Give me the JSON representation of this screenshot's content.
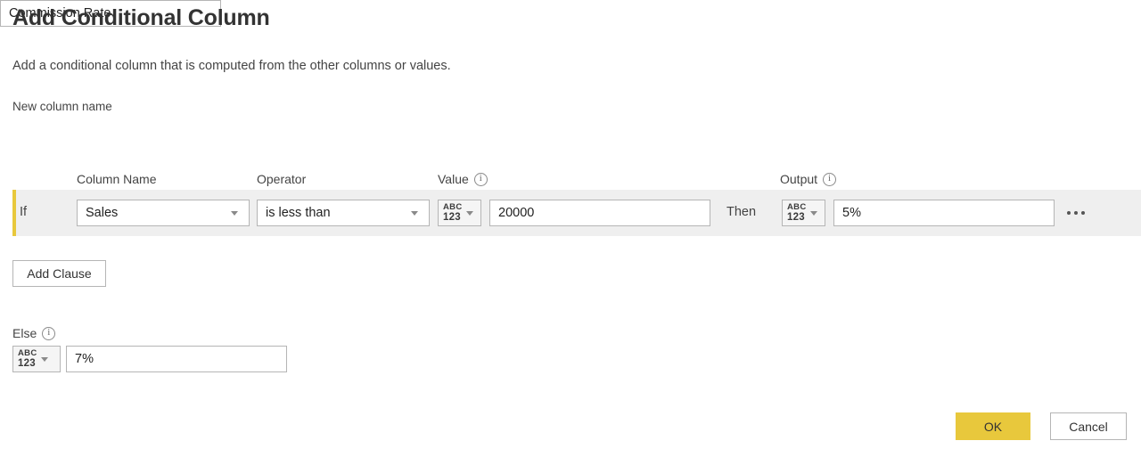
{
  "dialog": {
    "title": "Add Conditional Column",
    "description": "Add a conditional column that is computed from the other columns or values."
  },
  "new_column": {
    "label": "New column name",
    "value": "Commission Rate",
    "placeholder": "New column name"
  },
  "headers": {
    "column_name": "Column Name",
    "operator": "Operator",
    "value": "Value",
    "output": "Output",
    "value_info_icon": "info-icon",
    "output_info_icon": "info-icon"
  },
  "clause": {
    "if_label": "If",
    "then_label": "Then",
    "column_name": "Sales",
    "operator": "is less than",
    "value_type": {
      "abc": "ABC",
      "num": "123"
    },
    "value": "20000",
    "value_placeholder": "Enter a value",
    "output_type": {
      "abc": "ABC",
      "num": "123"
    },
    "output": "5%",
    "output_placeholder": "Enter a value",
    "more_icon": "ellipsis-icon",
    "accent_color": "#e8c83c",
    "row_background": "#efefef"
  },
  "add_clause": {
    "label": "Add Clause"
  },
  "else": {
    "label": "Else",
    "info_icon": "info-icon",
    "type": {
      "abc": "ABC",
      "num": "123"
    },
    "value": "7%",
    "placeholder": "Enter a value"
  },
  "footer": {
    "ok_label": "OK",
    "cancel_label": "Cancel",
    "ok_color": "#e8c83c"
  }
}
